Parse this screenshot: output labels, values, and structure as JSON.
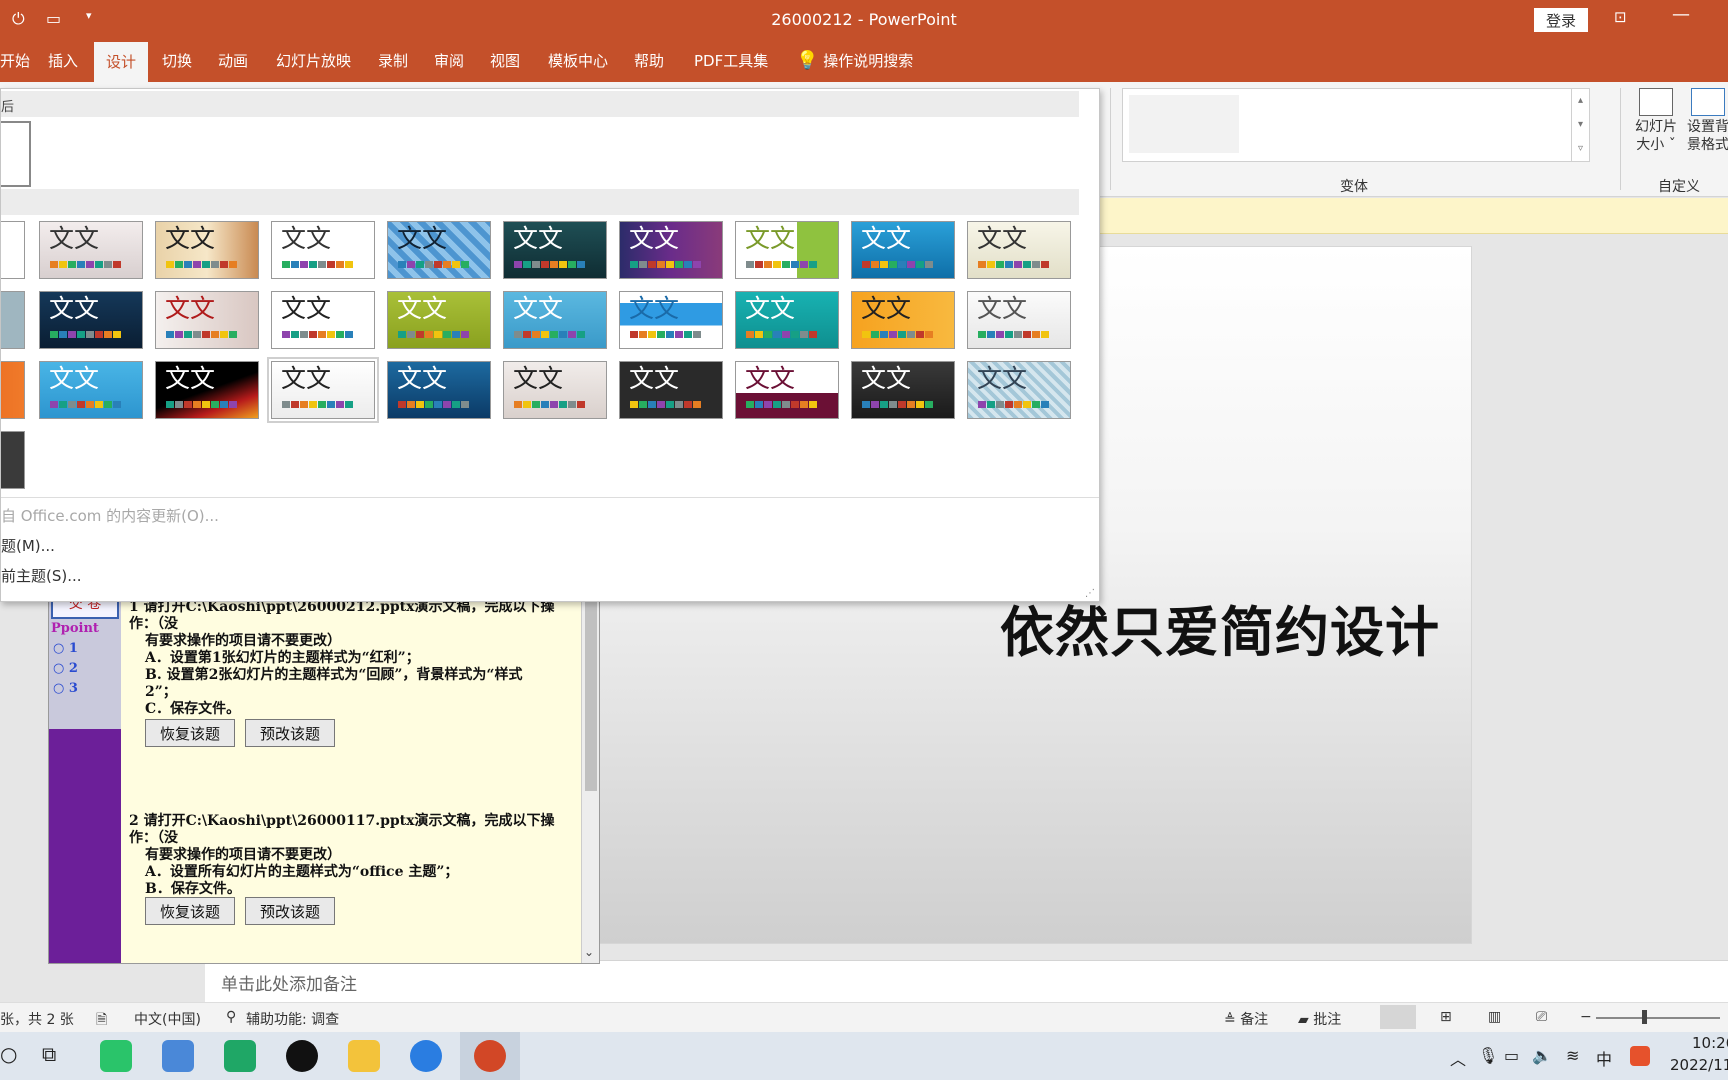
{
  "titlebar": {
    "title": "26000212  -  PowerPoint",
    "login": "登录",
    "qa_icons": [
      "save-icon",
      "slideshow-icon",
      "customize-icon"
    ]
  },
  "ribbon_tabs": [
    "开始",
    "插入",
    "设计",
    "切换",
    "动画",
    "幻灯片放映",
    "录制",
    "审阅",
    "视图",
    "模板中心",
    "帮助",
    "PDF工具集"
  ],
  "active_tab": "设计",
  "tell_me": "操作说明搜索",
  "ribbon": {
    "variants_label": "变体",
    "slide_size": "幻灯片\n大小 ˇ",
    "format_bg": "设置背\n景格式",
    "customize_label": "自定义"
  },
  "theme_panel": {
    "section1_label": "后",
    "themes": [
      {
        "bg": "#ffffff",
        "fg": "#333"
      },
      {
        "bg": "linear-gradient(#f3eded,#d8cfcf)",
        "fg": "#333"
      },
      {
        "bg": "linear-gradient(90deg,#e9d2a8,#f6e7c8,#c98a52)",
        "fg": "#222"
      },
      {
        "bg": "#ffffff",
        "fg": "#333"
      },
      {
        "bg": "repeating-linear-gradient(45deg,#4d95d0 0 6px,#8ec3ea 6px 12px)",
        "fg": "#123"
      },
      {
        "bg": "linear-gradient(#1f4f55,#0f2d33)",
        "fg": "#fff"
      },
      {
        "bg": "linear-gradient(90deg,#2c2c6a,#6a2c8a,#8a3b7a)",
        "fg": "#fff"
      },
      {
        "bg": "linear-gradient(90deg,#fff 60%,#8fc23f 60%)",
        "fg": "#7a9a2a"
      },
      {
        "bg": "linear-gradient(#2aa0d8,#0f6fa8)",
        "fg": "#fff"
      },
      {
        "bg": "linear-gradient(#f7f5e8,#e2dfc8)",
        "fg": "#333"
      },
      {
        "bg": "#9fb6c0",
        "fg": "#fff"
      },
      {
        "bg": "linear-gradient(#153859,#0a1e33)",
        "fg": "#fff"
      },
      {
        "bg": "linear-gradient(90deg,#f4f0ee,#d9c7c2)",
        "fg": "#b01b1b"
      },
      {
        "bg": "#ffffff",
        "fg": "#222"
      },
      {
        "bg": "linear-gradient(#a9c038,#8aa11f)",
        "fg": "#fff"
      },
      {
        "bg": "linear-gradient(#5bb8e0,#3a9ac9)",
        "fg": "#fff"
      },
      {
        "bg": "linear-gradient(#ffffff 0 20%,#2f9be3 20% 60%,#ffffff 60%)",
        "fg": "#1a6aa8"
      },
      {
        "bg": "linear-gradient(#18b2b2,#0f8f8f)",
        "fg": "#fff"
      },
      {
        "bg": "linear-gradient(90deg,#f6a21f,#f8b93f)",
        "fg": "#222"
      },
      {
        "bg": "linear-gradient(#fbfbfb,#e6e6e6)",
        "fg": "#555"
      },
      {
        "bg": "linear-gradient(90deg,#e35a12,#f07a2a)",
        "fg": "#fff"
      },
      {
        "bg": "linear-gradient(#49b5e6,#2d95cf)",
        "fg": "#fff"
      },
      {
        "bg": "linear-gradient(160deg,#000 50%,#b71b1b 75%,#f0a020)",
        "fg": "#fff"
      },
      {
        "bg": "linear-gradient(#ffffff,#ececec)",
        "fg": "#222"
      },
      {
        "bg": "linear-gradient(#1d6aa0,#0b3a66)",
        "fg": "#fff"
      },
      {
        "bg": "linear-gradient(#f1ecea,#d9d0cc)",
        "fg": "#222"
      },
      {
        "bg": "#2a2a2a",
        "fg": "#fff"
      },
      {
        "bg": "linear-gradient(#fff 0 55%,#6b1035 55%)",
        "fg": "#6b1035"
      },
      {
        "bg": "linear-gradient(#3a3a3a,#1a1a1a)",
        "fg": "#fff"
      },
      {
        "bg": "repeating-linear-gradient(45deg,#a4c7d8 0 4px,#d5e6ee 4px 8px)",
        "fg": "#345"
      },
      {
        "bg": "#3a3a3a",
        "fg": "#fff"
      }
    ],
    "theme_text": "文文",
    "links": [
      "自 Office.com 的内容更新(O)...",
      "题(M)...",
      "前主题(S)..."
    ]
  },
  "exam": {
    "tab_label": "交 卷",
    "app_label": "Ppoint",
    "nav_numbers": [
      "1",
      "2",
      "3"
    ],
    "q1": {
      "line1": "1  请打开C:\\Kaoshi\\ppt\\26000212.pptx演示文稿，完成以下操作：（没",
      "line2": "有要求操作的项目请不要更改）",
      "line3": "A．设置第1张幻灯片的主题样式为“红利”；",
      "line4": "B. 设置第2张幻灯片的主题样式为“回顾”，背景样式为“样式",
      "line5": "2”；",
      "line6": "C．保存文件。"
    },
    "q2": {
      "line1": "2  请打开C:\\Kaoshi\\ppt\\26000117.pptx演示文稿，完成以下操作：（没",
      "line2": "有要求操作的项目请不要更改）",
      "line3": "A．设置所有幻灯片的主题样式为“office 主题”；",
      "line4": "B．保存文件。"
    },
    "restore_btn": "恢复该题",
    "redo_btn": "预改该题"
  },
  "slide": {
    "title": "依然只爱简约设计"
  },
  "notes": "单击此处添加备注",
  "status": {
    "slide_count": "张，共 2 张",
    "language": "中文(中国)",
    "accessibility": "辅助功能: 调查",
    "notes_btn": "备注",
    "comments_btn": "批注"
  },
  "taskbar": {
    "ime": "中",
    "time": "10:26",
    "date": "2022/11"
  },
  "colors": {
    "accent": "#c4502a",
    "exam_side": "#6c1f99",
    "exam_bg": "#fffde0"
  }
}
